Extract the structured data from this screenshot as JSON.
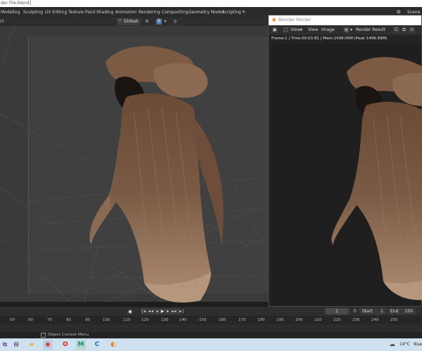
{
  "window": {
    "title": "[C:\\Users\\...\\Desktop\\Cartoon Hair File.blend]",
    "title_visible": "der File.blend]"
  },
  "workspaces": [
    "Modeling",
    "Sculpting",
    "UV Editing",
    "Texture Paint",
    "Shading",
    "Animation",
    "Rendering",
    "Compositing",
    "Geometry Nodes",
    "Scripting"
  ],
  "workspace_add": "+",
  "scene": {
    "icon": "scene-icon",
    "label": "Scene"
  },
  "viewport": {
    "mode_fragment": "ct",
    "orientation": {
      "icon": "transform-orientation-icon",
      "label": "Global",
      "arrow": "▾"
    },
    "tools": [
      "pivot-icon",
      "snap-icon",
      "snap-settings-icon",
      "proportional-icon"
    ],
    "tool_glyphs": [
      "⚙",
      "⦿",
      "▾",
      "◎"
    ]
  },
  "render_window": {
    "title": "Blender Render",
    "header": {
      "view": "View",
      "view_arrow": "▾",
      "view_menu": "View",
      "image_menu": "Image",
      "slot_label": "Render Result"
    },
    "status": "Frame:1 | Time:00:03.81 | Mem:1438.05M (Peak 1499.59M)"
  },
  "timeline": {
    "playback": "|◂ ◂◂ ◂ ▶ ▸ ▸▸ ▸|",
    "current_frame": "1",
    "start_label": "Start",
    "start": "1",
    "end_label": "End",
    "end": "250",
    "ticks": [
      "50",
      "60",
      "70",
      "80",
      "90",
      "100",
      "110",
      "120",
      "130",
      "140",
      "150",
      "160",
      "170",
      "180",
      "190",
      "200",
      "210",
      "220",
      "230",
      "240",
      "250"
    ]
  },
  "statusbar": {
    "text": "Object Context Menu"
  },
  "taskbar": {
    "apps": [
      {
        "name": "task-view-icon",
        "glyph": "⧉"
      },
      {
        "name": "file-explorer-icon",
        "glyph": "▰"
      },
      {
        "name": "chrome-icon",
        "glyph": "◉"
      },
      {
        "name": "opera-icon",
        "glyph": "O"
      },
      {
        "name": "app-m-icon",
        "glyph": "M"
      },
      {
        "name": "cortana-icon",
        "glyph": "C"
      },
      {
        "name": "blender-icon",
        "glyph": "◐"
      }
    ],
    "temperature": "14°C",
    "weather": "Nuag"
  }
}
